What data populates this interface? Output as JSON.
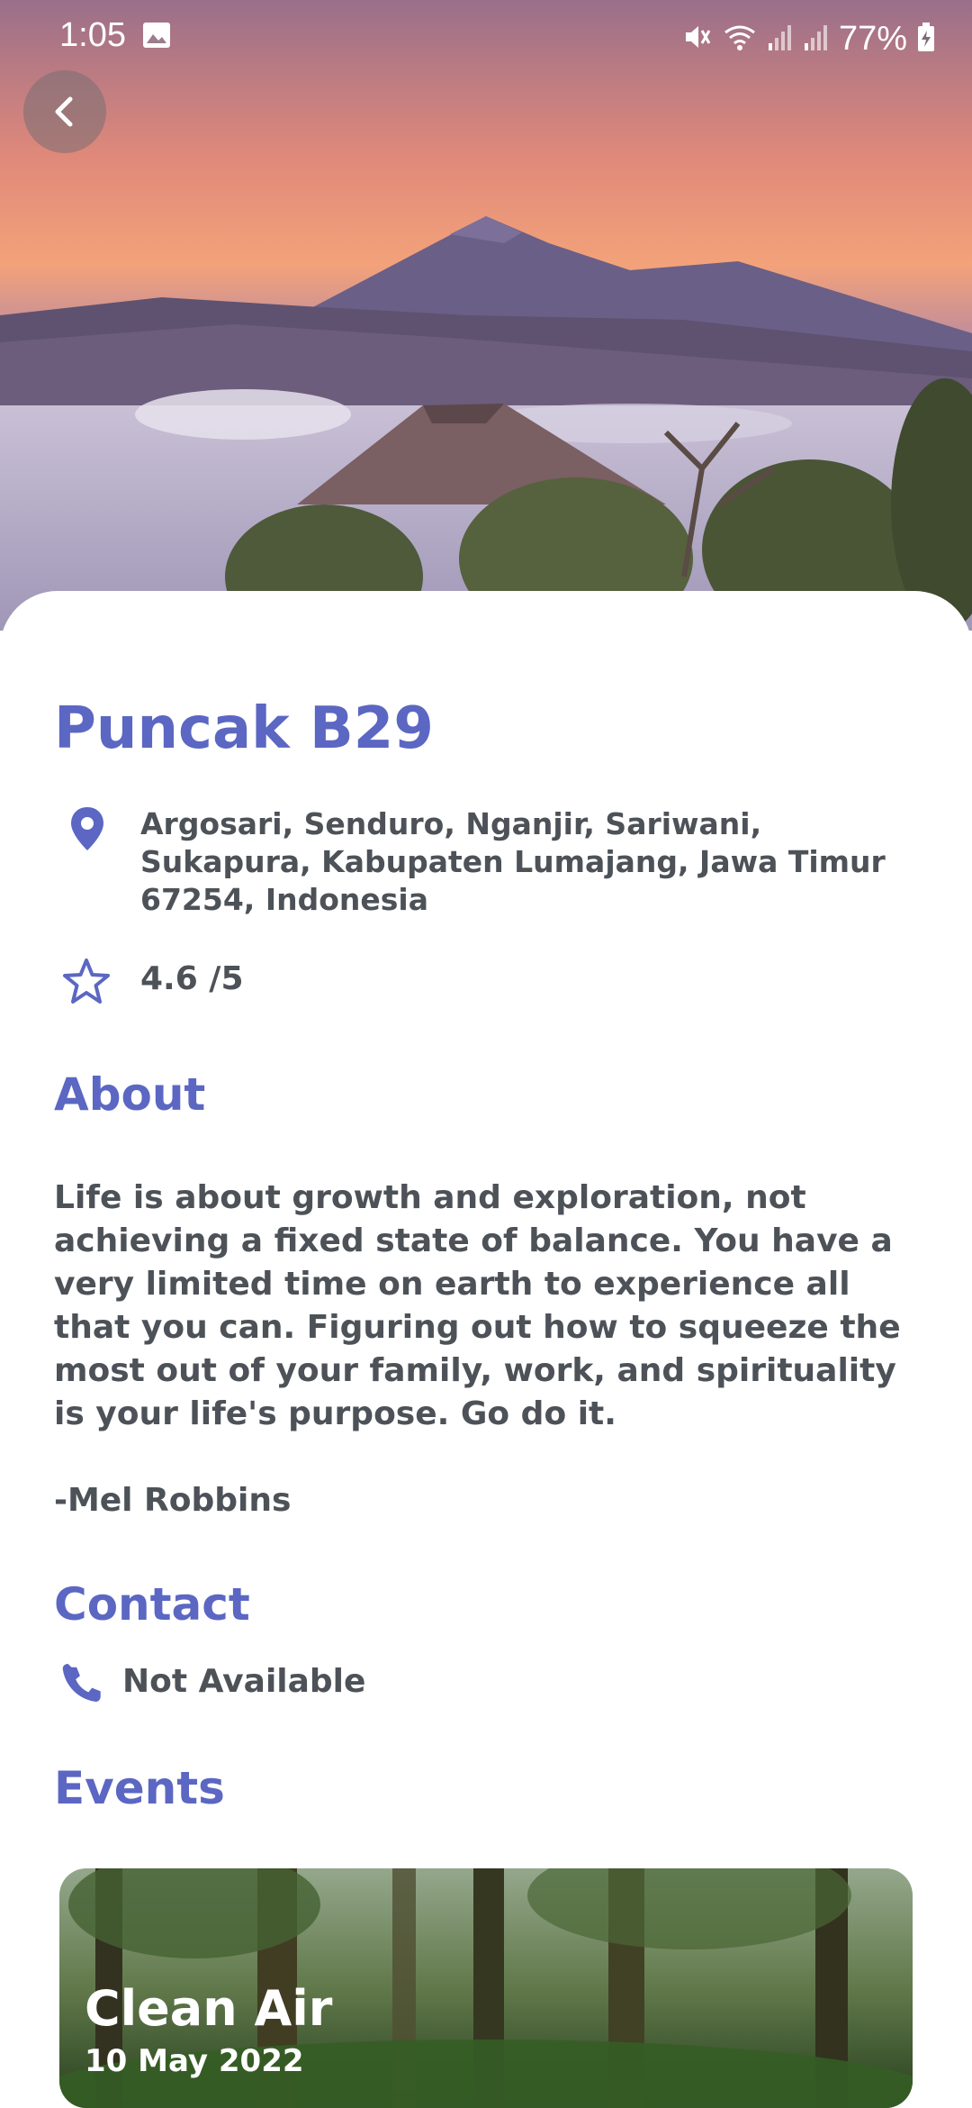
{
  "status_bar": {
    "time": "1:05",
    "battery": "77%"
  },
  "place": {
    "name": "Puncak B29",
    "address": "Argosari, Senduro, Nganjir, Sariwani, Sukapura, Kabupaten Lumajang, Jawa Timur 67254, Indonesia",
    "rating": "4.6 /5"
  },
  "about": {
    "heading": "About",
    "text": "Life is about growth and exploration, not achieving a fixed state of balance. You have a very limited time on earth to experience all that you can. Figuring out how to squeeze the most out of your family, work, and spirituality is your life's purpose. Go do it.\n\n-Mel Robbins"
  },
  "contact": {
    "heading": "Contact",
    "value": "Not Available"
  },
  "events": {
    "heading": "Events",
    "items": [
      {
        "title": "Clean Air",
        "date": "10 May 2022"
      }
    ]
  },
  "theme": {
    "accent": "#5b67c2",
    "text": "#4d5258"
  },
  "icons": [
    "back-arrow-icon",
    "location-pin-icon",
    "star-icon",
    "phone-icon",
    "image-icon",
    "mute-icon",
    "wifi-icon",
    "signal-icon",
    "battery-icon"
  ]
}
